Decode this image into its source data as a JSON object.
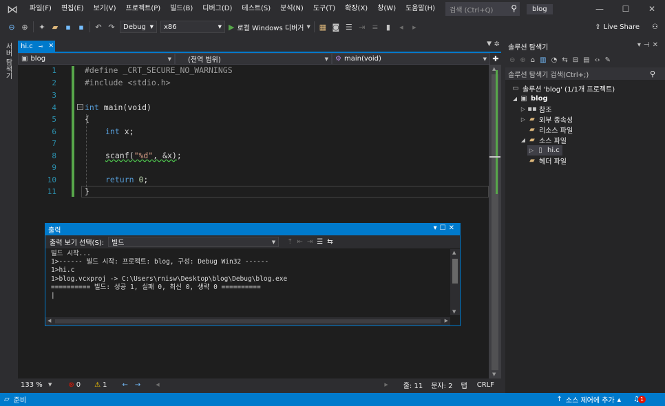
{
  "menu": {
    "items": [
      "파일(F)",
      "편집(E)",
      "보기(V)",
      "프로젝트(P)",
      "빌드(B)",
      "디버그(D)",
      "테스트(S)",
      "분석(N)",
      "도구(T)",
      "확장(X)",
      "창(W)",
      "도움말(H)"
    ],
    "search_placeholder": "검색 (Ctrl+Q)",
    "solution_name": "blog"
  },
  "toolbar": {
    "config": "Debug",
    "platform": "x86",
    "run_label": "로컬 Windows 디버거",
    "live_share": "Live Share"
  },
  "left_panel": {
    "label": "서버 탐색기"
  },
  "editor": {
    "tab_name": "hi.c",
    "nav_project": "blog",
    "nav_scope": "(전역 범위)",
    "nav_function": "main(void)",
    "line_numbers": [
      "1",
      "2",
      "3",
      "4",
      "5",
      "6",
      "7",
      "8",
      "9",
      "10",
      "11"
    ],
    "zoom": "133 %",
    "errors": "0",
    "warnings": "1",
    "line_info": "줄: 11",
    "char_info": "문자: 2",
    "tab_info": "탭",
    "eol": "CRLF"
  },
  "code": {
    "l1_directive": "#define",
    "l1_rest": " _CRT_SECURE_NO_WARNINGS",
    "l2_directive": "#include",
    "l2_rest": " <stdio.h>",
    "l4_kw": "int",
    "l4_rest": " main(void)",
    "l5": "{",
    "l6_kw": "int",
    "l6_rest": " x;",
    "l8_fn": "scanf",
    "l8_open": "(",
    "l8_str": "\"%d\"",
    "l8_rest": ", &x)",
    "l8_end": ";",
    "l10_kw": "return",
    "l10_num": "0",
    "l10_end": ";",
    "l11": "}"
  },
  "output": {
    "title": "출력",
    "source_label": "출력 보기 선택(S):",
    "source_value": "빌드",
    "lines": [
      "빌드 시작...",
      "1>------ 빌드 시작: 프로젝트: blog, 구성: Debug Win32 ------",
      "1>hi.c",
      "1>blog.vcxproj -> C:\\Users\\rnisw\\Desktop\\blog\\Debug\\blog.exe",
      "========== 빌드: 성공 1, 실패 0, 최신 0, 생략 0 ==========",
      "|"
    ]
  },
  "solution_explorer": {
    "title": "솔루션 탐색기",
    "search_placeholder": "솔루션 탐색기 검색(Ctrl+;)",
    "solution_label": "솔루션 'blog' (1/1개 프로젝트)",
    "project": "blog",
    "references": "참조",
    "external_deps": "외부 종속성",
    "resource_files": "리소스 파일",
    "source_files": "소스 파일",
    "file": "hi.c",
    "header_files": "헤더 파일"
  },
  "status": {
    "ready": "준비",
    "source_control": "소스 제어에 추가",
    "notifications": "1"
  },
  "colors": {
    "accent": "#007acc",
    "background": "#1e1e1e",
    "chrome": "#2d2d30"
  }
}
